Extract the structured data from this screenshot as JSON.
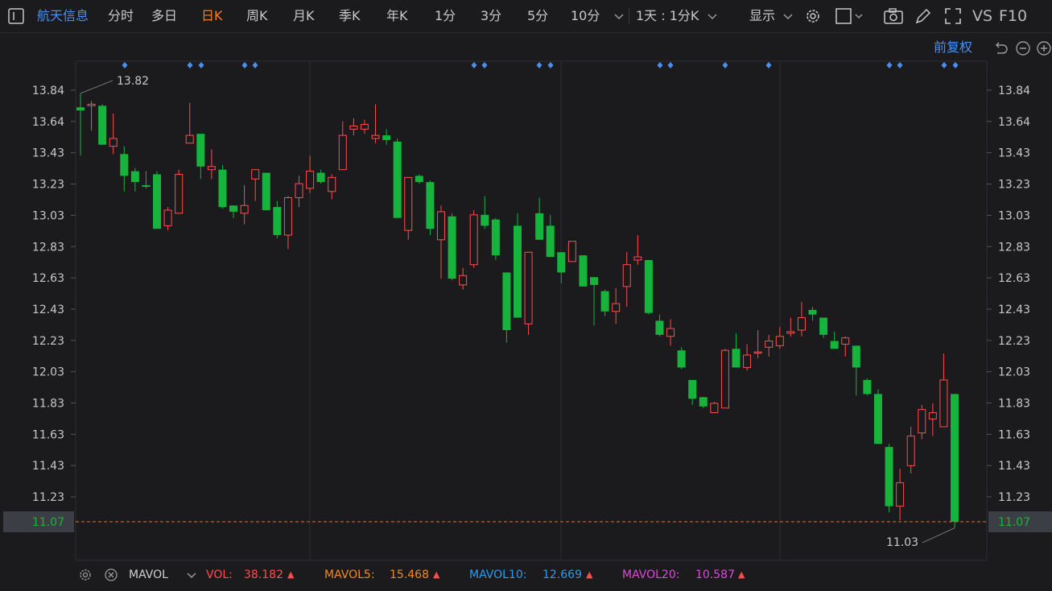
{
  "toolbar": {
    "stock_name": "航天信息",
    "periods": [
      "分时",
      "多日",
      "日K",
      "周K",
      "月K",
      "季K",
      "年K",
      "1分",
      "3分",
      "5分",
      "10分"
    ],
    "active_period": "日K",
    "range_select": "1天 : 1分K",
    "display_label": "显示",
    "right_labels": [
      "VS",
      "F10"
    ]
  },
  "chart_controls": {
    "adjust_label": "前复权"
  },
  "chart_data": {
    "type": "candlestick",
    "price_axis_ticks": [
      "13.84",
      "13.64",
      "13.43",
      "13.23",
      "13.03",
      "12.83",
      "12.63",
      "12.43",
      "12.23",
      "12.03",
      "11.83",
      "11.63",
      "11.43",
      "11.23"
    ],
    "ylim": [
      10.96,
      14.0
    ],
    "current_price": "11.07",
    "high_marker": "13.82",
    "low_marker": "11.03",
    "up_color": "#ff4d4d",
    "down_color": "#16b43c",
    "candles": [
      {
        "o": 13.73,
        "c": 13.71,
        "h": 13.82,
        "l": 13.42
      },
      {
        "o": 13.74,
        "c": 13.75,
        "h": 13.77,
        "l": 13.58
      },
      {
        "o": 13.74,
        "c": 13.49,
        "h": 13.75,
        "l": 13.49
      },
      {
        "o": 13.48,
        "c": 13.53,
        "h": 13.69,
        "l": 13.43
      },
      {
        "o": 13.43,
        "c": 13.29,
        "h": 13.48,
        "l": 13.19
      },
      {
        "o": 13.32,
        "c": 13.25,
        "h": 13.34,
        "l": 13.19
      },
      {
        "o": 13.23,
        "c": 13.22,
        "h": 13.32,
        "l": 13.21
      },
      {
        "o": 13.3,
        "c": 12.95,
        "h": 13.32,
        "l": 12.95
      },
      {
        "o": 12.97,
        "c": 13.07,
        "h": 13.09,
        "l": 12.94
      },
      {
        "o": 13.05,
        "c": 13.3,
        "h": 13.33,
        "l": 13.05
      },
      {
        "o": 13.5,
        "c": 13.55,
        "h": 13.76,
        "l": 13.5
      },
      {
        "o": 13.56,
        "c": 13.35,
        "h": 13.56,
        "l": 13.27
      },
      {
        "o": 13.33,
        "c": 13.35,
        "h": 13.46,
        "l": 13.27
      },
      {
        "o": 13.33,
        "c": 13.09,
        "h": 13.36,
        "l": 13.08
      },
      {
        "o": 13.1,
        "c": 13.06,
        "h": 13.1,
        "l": 13.02
      },
      {
        "o": 13.05,
        "c": 13.1,
        "h": 13.23,
        "l": 12.98
      },
      {
        "o": 13.27,
        "c": 13.33,
        "h": 13.33,
        "l": 13.13
      },
      {
        "o": 13.31,
        "c": 13.07,
        "h": 13.31,
        "l": 13.07
      },
      {
        "o": 13.09,
        "c": 12.91,
        "h": 13.13,
        "l": 12.89
      },
      {
        "o": 12.91,
        "c": 13.15,
        "h": 13.16,
        "l": 12.82
      },
      {
        "o": 13.15,
        "c": 13.24,
        "h": 13.29,
        "l": 13.09
      },
      {
        "o": 13.21,
        "c": 13.32,
        "h": 13.42,
        "l": 13.18
      },
      {
        "o": 13.31,
        "c": 13.25,
        "h": 13.33,
        "l": 13.24
      },
      {
        "o": 13.19,
        "c": 13.28,
        "h": 13.3,
        "l": 13.14
      },
      {
        "o": 13.33,
        "c": 13.55,
        "h": 13.64,
        "l": 13.33
      },
      {
        "o": 13.59,
        "c": 13.61,
        "h": 13.66,
        "l": 13.55
      },
      {
        "o": 13.59,
        "c": 13.62,
        "h": 13.65,
        "l": 13.56
      },
      {
        "o": 13.53,
        "c": 13.55,
        "h": 13.75,
        "l": 13.5
      },
      {
        "o": 13.55,
        "c": 13.52,
        "h": 13.59,
        "l": 13.49
      },
      {
        "o": 13.51,
        "c": 13.02,
        "h": 13.53,
        "l": 13.02
      },
      {
        "o": 12.94,
        "c": 13.28,
        "h": 13.28,
        "l": 12.88
      },
      {
        "o": 13.29,
        "c": 13.25,
        "h": 13.3,
        "l": 13.24
      },
      {
        "o": 13.25,
        "c": 12.95,
        "h": 13.26,
        "l": 12.91
      },
      {
        "o": 12.88,
        "c": 13.06,
        "h": 13.1,
        "l": 12.63
      },
      {
        "o": 13.03,
        "c": 12.63,
        "h": 13.05,
        "l": 12.62
      },
      {
        "o": 12.59,
        "c": 12.65,
        "h": 12.7,
        "l": 12.56
      },
      {
        "o": 12.72,
        "c": 13.04,
        "h": 13.07,
        "l": 12.7
      },
      {
        "o": 13.04,
        "c": 12.97,
        "h": 13.16,
        "l": 12.95
      },
      {
        "o": 13.01,
        "c": 12.78,
        "h": 13.02,
        "l": 12.75
      },
      {
        "o": 12.67,
        "c": 12.3,
        "h": 12.67,
        "l": 12.22
      },
      {
        "o": 12.97,
        "c": 12.38,
        "h": 13.05,
        "l": 12.38
      },
      {
        "o": 12.34,
        "c": 12.8,
        "h": 12.8,
        "l": 12.27
      },
      {
        "o": 13.05,
        "c": 12.88,
        "h": 13.15,
        "l": 12.88
      },
      {
        "o": 12.97,
        "c": 12.77,
        "h": 13.04,
        "l": 12.77
      },
      {
        "o": 12.8,
        "c": 12.67,
        "h": 12.8,
        "l": 12.6
      },
      {
        "o": 12.74,
        "c": 12.87,
        "h": 12.87,
        "l": 12.75
      },
      {
        "o": 12.78,
        "c": 12.58,
        "h": 12.78,
        "l": 12.58
      },
      {
        "o": 12.64,
        "c": 12.59,
        "h": 12.64,
        "l": 12.33
      },
      {
        "o": 12.55,
        "c": 12.42,
        "h": 12.56,
        "l": 12.39
      },
      {
        "o": 12.42,
        "c": 12.47,
        "h": 12.57,
        "l": 12.34
      },
      {
        "o": 12.58,
        "c": 12.72,
        "h": 12.8,
        "l": 12.45
      },
      {
        "o": 12.75,
        "c": 12.77,
        "h": 12.91,
        "l": 12.72
      },
      {
        "o": 12.75,
        "c": 12.41,
        "h": 12.75,
        "l": 12.4
      },
      {
        "o": 12.36,
        "c": 12.27,
        "h": 12.4,
        "l": 12.26
      },
      {
        "o": 12.26,
        "c": 12.31,
        "h": 12.37,
        "l": 12.2
      },
      {
        "o": 12.17,
        "c": 12.06,
        "h": 12.19,
        "l": 12.05
      },
      {
        "o": 11.98,
        "c": 11.86,
        "h": 11.98,
        "l": 11.82
      },
      {
        "o": 11.87,
        "c": 11.81,
        "h": 11.87,
        "l": 11.8
      },
      {
        "o": 11.77,
        "c": 11.83,
        "h": 11.84,
        "l": 11.77
      },
      {
        "o": 11.8,
        "c": 12.17,
        "h": 12.18,
        "l": 11.8
      },
      {
        "o": 12.18,
        "c": 12.06,
        "h": 12.28,
        "l": 12.06
      },
      {
        "o": 12.06,
        "c": 12.14,
        "h": 12.21,
        "l": 12.04
      },
      {
        "o": 12.16,
        "c": 12.16,
        "h": 12.3,
        "l": 12.12
      },
      {
        "o": 12.19,
        "c": 12.23,
        "h": 12.27,
        "l": 12.13
      },
      {
        "o": 12.2,
        "c": 12.26,
        "h": 12.32,
        "l": 12.18
      },
      {
        "o": 12.28,
        "c": 12.29,
        "h": 12.38,
        "l": 12.26
      },
      {
        "o": 12.3,
        "c": 12.38,
        "h": 12.48,
        "l": 12.26
      },
      {
        "o": 12.43,
        "c": 12.4,
        "h": 12.45,
        "l": 12.36
      },
      {
        "o": 12.38,
        "c": 12.27,
        "h": 12.38,
        "l": 12.25
      },
      {
        "o": 12.23,
        "c": 12.18,
        "h": 12.29,
        "l": 12.18
      },
      {
        "o": 12.21,
        "c": 12.25,
        "h": 12.26,
        "l": 12.13
      },
      {
        "o": 12.2,
        "c": 12.06,
        "h": 12.2,
        "l": 11.88
      },
      {
        "o": 11.98,
        "c": 11.89,
        "h": 11.99,
        "l": 11.88
      },
      {
        "o": 11.89,
        "c": 11.57,
        "h": 11.92,
        "l": 11.57
      },
      {
        "o": 11.55,
        "c": 11.17,
        "h": 11.57,
        "l": 11.13
      },
      {
        "o": 11.17,
        "c": 11.32,
        "h": 11.41,
        "l": 11.08
      },
      {
        "o": 11.43,
        "c": 11.62,
        "h": 11.68,
        "l": 11.38
      },
      {
        "o": 11.64,
        "c": 11.79,
        "h": 11.82,
        "l": 11.6
      },
      {
        "o": 11.73,
        "c": 11.77,
        "h": 11.83,
        "l": 11.62
      },
      {
        "o": 11.68,
        "c": 11.98,
        "h": 12.15,
        "l": 11.68
      },
      {
        "o": 11.89,
        "c": 11.07,
        "h": 11.89,
        "l": 11.03
      }
    ]
  },
  "legend": {
    "indicator": "MAVOL",
    "vol_label": "VOL:",
    "vol_value": "38.182",
    "mavol5_label": "MAVOL5:",
    "mavol5_value": "15.468",
    "mavol10_label": "MAVOL10:",
    "mavol10_value": "12.669",
    "mavol20_label": "MAVOL20:",
    "mavol20_value": "10.587"
  }
}
